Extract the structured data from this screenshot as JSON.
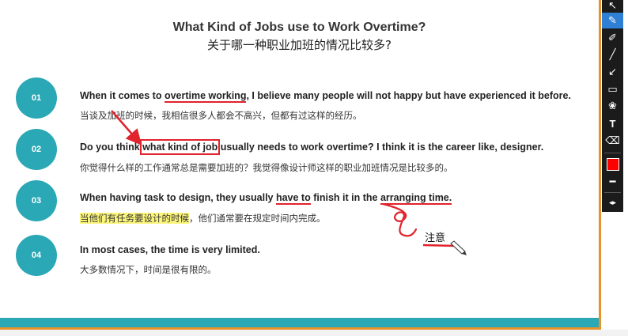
{
  "slide": {
    "title": "What Kind of Jobs use to Work Overtime?",
    "title_cn": "关于哪一种职业加班的情况比较多?",
    "items": [
      {
        "num": "01",
        "en_before": "When it comes to ",
        "en_mark": "overtime working",
        "en_after": ", I believe many people will not happy but have experienced it before.",
        "cn": "当谈及加班的时候，我相信很多人都会不高兴，但都有过这样的经历。"
      },
      {
        "num": "02",
        "en_before": "Do you think ",
        "en_mark": "what kind of job",
        "en_after": " usually needs to work overtime? I think it is the career like, designer.",
        "cn": "你觉得什么样的工作通常总是需要加班的？我觉得像设计师这样的职业加班情况是比较多的。"
      },
      {
        "num": "03",
        "en_before": "When having task to design, they usually ",
        "en_mark": "have to",
        "en_mid": " finish it in the ",
        "en_mark2": "arranging time.",
        "cn_highlight": "当他们有任务要设计的时候",
        "cn_rest": "，他们通常要在规定时间内完成。"
      },
      {
        "num": "04",
        "en": "In most cases, the time is very limited.",
        "cn": "大多数情况下，时间是很有限的。"
      }
    ],
    "annotation": "注意"
  },
  "toolbar": {
    "tools": [
      {
        "name": "pointer-tool",
        "icon": "↖"
      },
      {
        "name": "pen-tool",
        "icon": "✎",
        "active": true
      },
      {
        "name": "highlighter-tool",
        "icon": "✐"
      },
      {
        "name": "line-tool",
        "icon": "╱"
      },
      {
        "name": "arrow-tool",
        "icon": "↙"
      },
      {
        "name": "rectangle-tool",
        "icon": "▭"
      },
      {
        "name": "shapes-tool",
        "icon": "❀"
      },
      {
        "name": "text-tool",
        "icon": "T"
      },
      {
        "name": "eraser-tool",
        "icon": "⌫"
      }
    ],
    "color": "#ff0000",
    "stroke_icon": "━",
    "expand_icon": "◂▸"
  }
}
